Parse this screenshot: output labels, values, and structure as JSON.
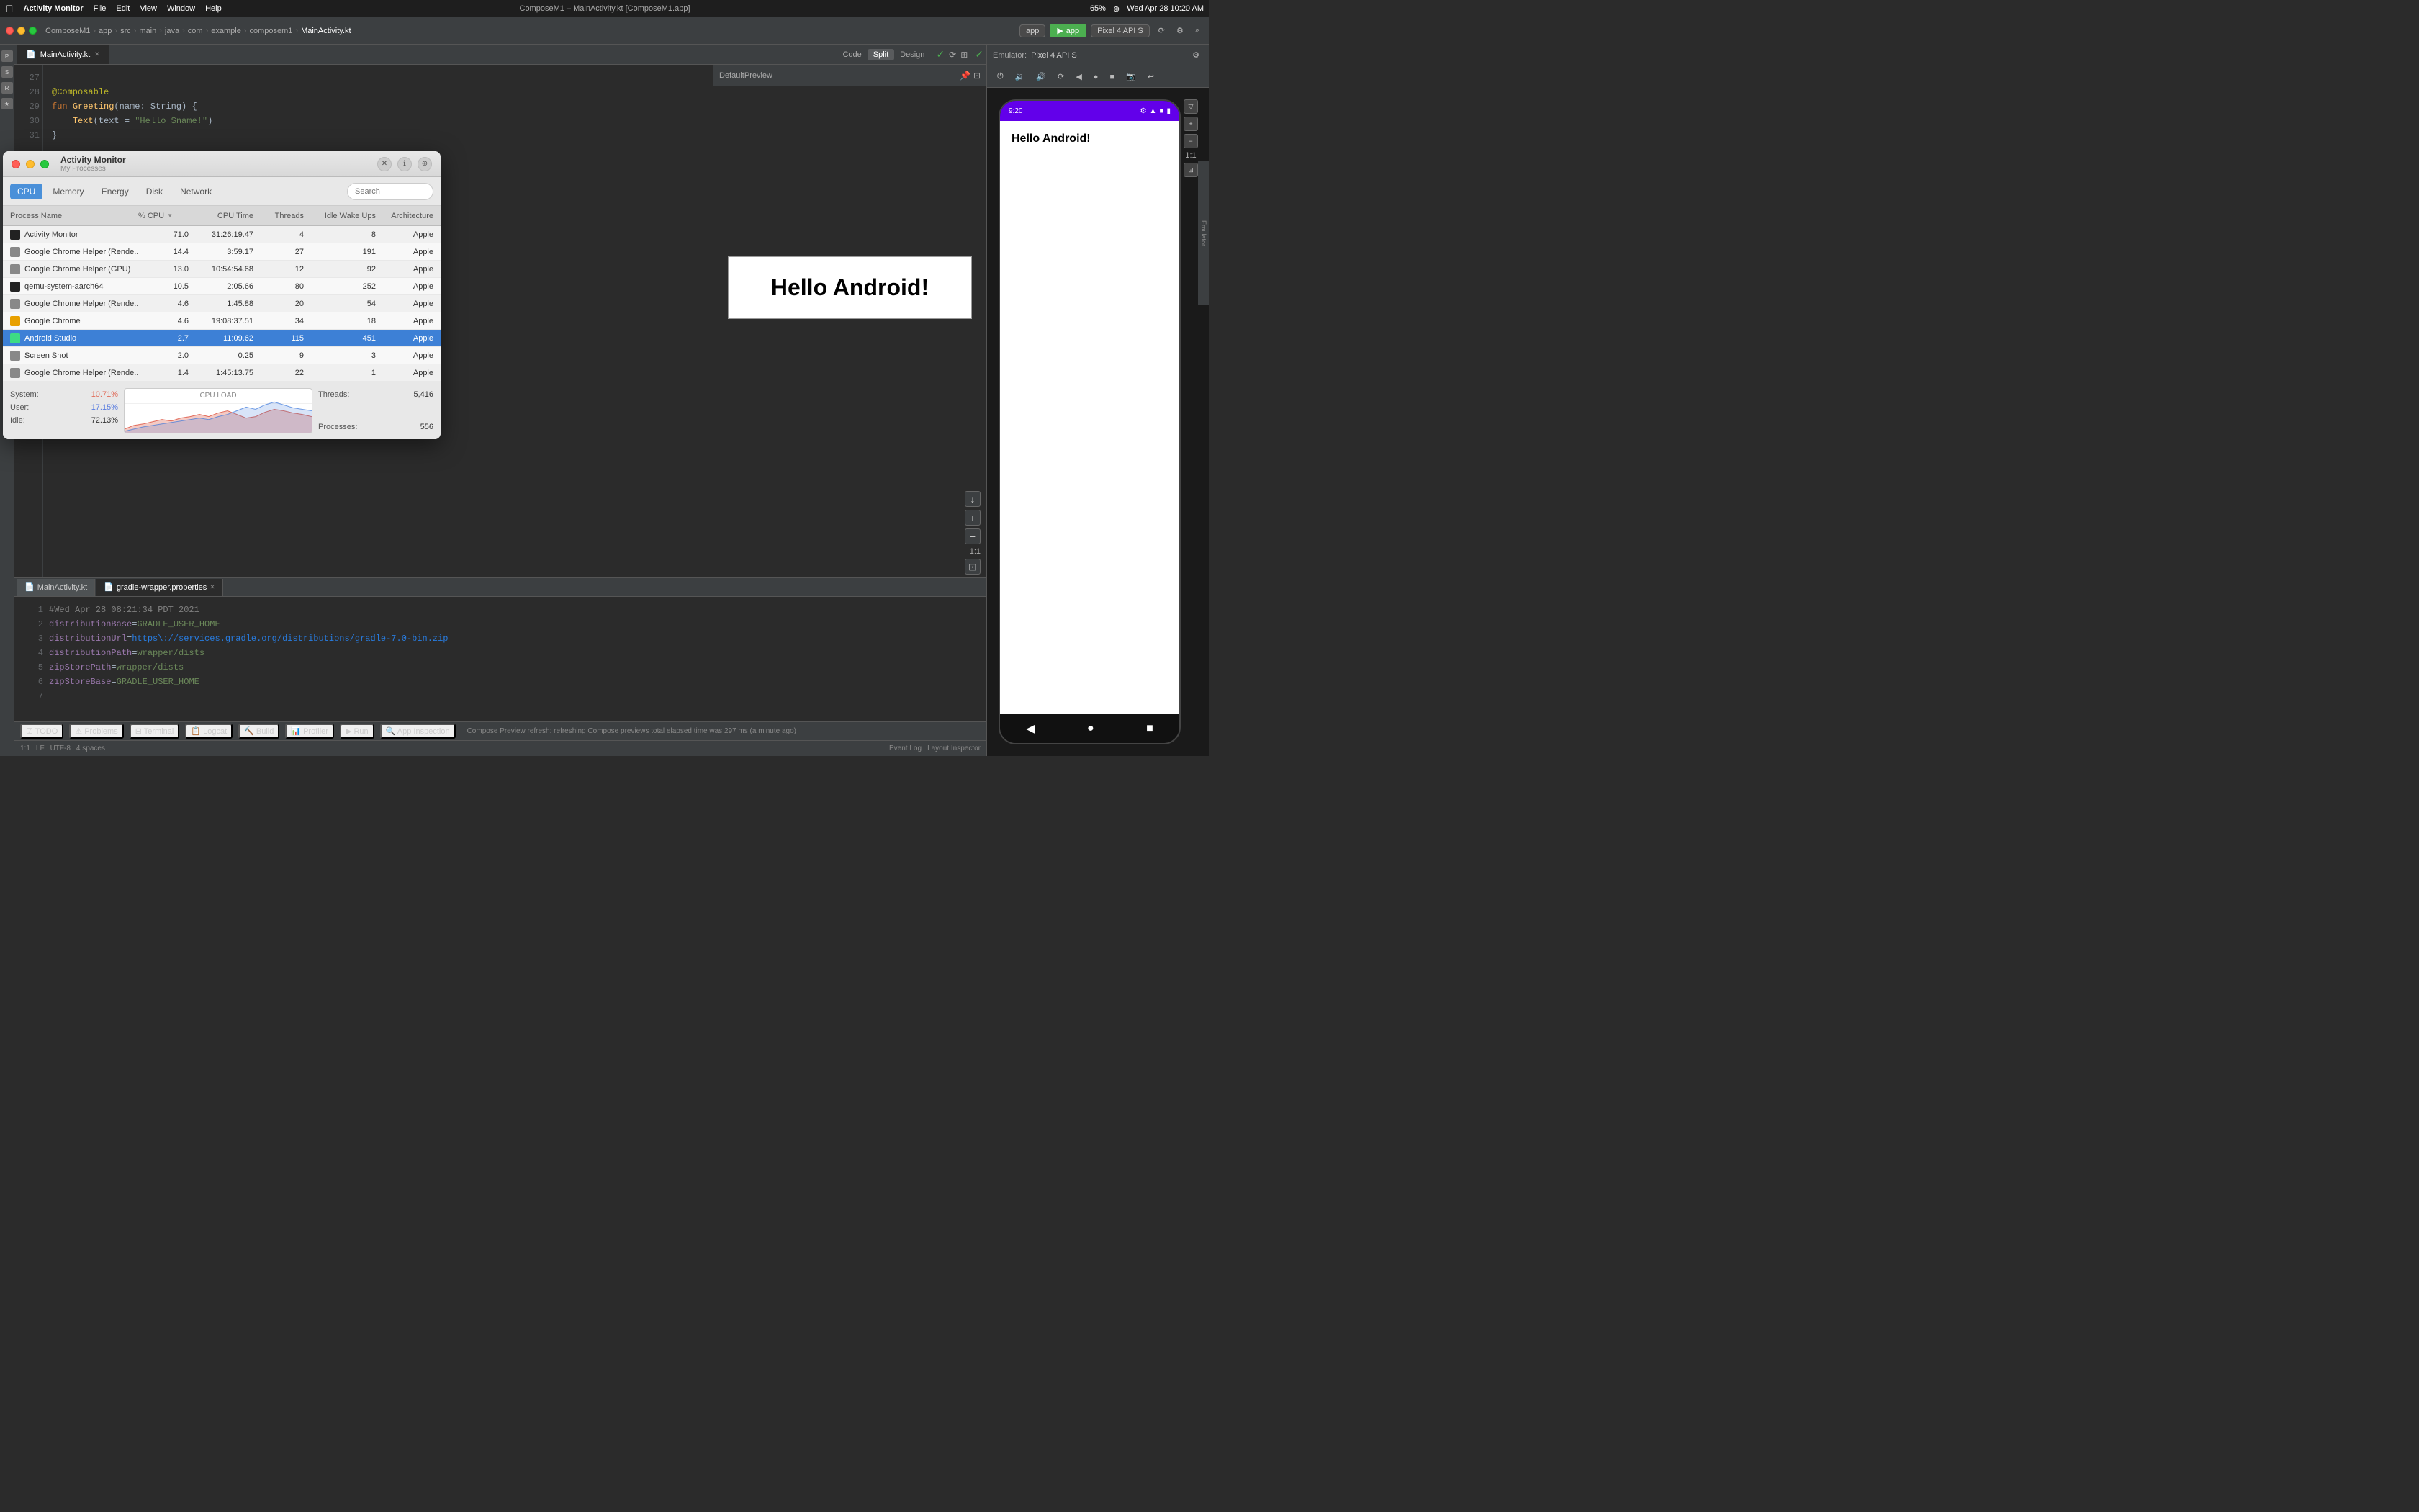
{
  "menubar": {
    "app_menu": "Activity Monitor",
    "menus": [
      "File",
      "Edit",
      "View",
      "Window",
      "Help"
    ],
    "center_title": "ComposeM1 – MainActivity.kt [ComposeM1.app]",
    "right_items": [
      "65%",
      "Wed Apr 28  10:20 AM"
    ]
  },
  "ide": {
    "title": "ComposeM1 – MainActivity.kt [ComposeM1.app]",
    "breadcrumbs": [
      "ComposeM1",
      "app",
      "src",
      "main",
      "java",
      "com",
      "example",
      "composem1",
      "MainActivity.kt"
    ],
    "tabs": {
      "editor": [
        "MainActivity.kt"
      ],
      "bottom": [
        "MainActivity.kt",
        "gradle-wrapper.properties"
      ]
    },
    "active_bottom_tab": "gradle-wrapper.properties",
    "run_config": "app",
    "device": "Pixel 4 API S",
    "view_tabs": [
      "Code",
      "Split",
      "Design"
    ],
    "active_view_tab": "Split"
  },
  "code": {
    "lines": [
      {
        "num": "27",
        "content": ""
      },
      {
        "num": "28",
        "content": "    @Composable"
      },
      {
        "num": "29",
        "content": "    fun Greeting(name: String) {"
      },
      {
        "num": "30",
        "content": "        Text(text = \"Hello $name!\")"
      },
      {
        "num": "31",
        "content": "    }"
      }
    ]
  },
  "gradle": {
    "lines": [
      {
        "num": "1",
        "content": "#Wed Apr 28 08:21:34 PDT 2021",
        "type": "comment"
      },
      {
        "num": "2",
        "content": "distributionBase=GRADLE_USER_HOME",
        "type": "prop"
      },
      {
        "num": "3",
        "content": "distributionUrl=https\\://services.gradle.org/distributions/gradle-7.0-bin.zip",
        "type": "url"
      },
      {
        "num": "4",
        "content": "distributionPath=wrapper/dists",
        "type": "prop"
      },
      {
        "num": "5",
        "content": "zipStorePath=wrapper/dists",
        "type": "prop"
      },
      {
        "num": "6",
        "content": "zipStoreBase=GRADLE_USER_HOME",
        "type": "prop"
      },
      {
        "num": "7",
        "content": "",
        "type": "empty"
      }
    ]
  },
  "preview": {
    "label": "DefaultPreview",
    "text": "Hello Android!",
    "zoom_levels": [
      "1:1",
      "+",
      "-",
      "fit"
    ]
  },
  "emulator": {
    "label": "Emulator:",
    "device": "Pixel 4 API S",
    "phone": {
      "time": "9:20",
      "title": "Hello Android!",
      "content": "Hello Android!",
      "nav_back": "◀",
      "nav_home": "●",
      "nav_recents": "■"
    }
  },
  "activity_monitor": {
    "title": "Activity Monitor",
    "subtitle": "My Processes",
    "tabs": [
      "CPU",
      "Memory",
      "Energy",
      "Disk",
      "Network"
    ],
    "active_tab": "CPU",
    "columns": [
      "Process Name",
      "% CPU",
      "CPU Time",
      "Threads",
      "Idle Wake Ups",
      "Architecture"
    ],
    "processes": [
      {
        "icon": "black",
        "name": "Activity Monitor",
        "cpu": "71.0",
        "cputime": "31:26:19.47",
        "threads": "4",
        "idle": "8",
        "arch": "Apple"
      },
      {
        "icon": "gray",
        "name": "Google Chrome Helper (Rende...",
        "cpu": "14.4",
        "cputime": "3:59.17",
        "threads": "27",
        "idle": "191",
        "arch": "Apple"
      },
      {
        "icon": "gray",
        "name": "Google Chrome Helper (GPU)",
        "cpu": "13.0",
        "cputime": "10:54:54.68",
        "threads": "12",
        "idle": "92",
        "arch": "Apple"
      },
      {
        "icon": "black",
        "name": "qemu-system-aarch64",
        "cpu": "10.5",
        "cputime": "2:05.66",
        "threads": "80",
        "idle": "252",
        "arch": "Apple"
      },
      {
        "icon": "gray",
        "name": "Google Chrome Helper (Rende...",
        "cpu": "4.6",
        "cputime": "1:45.88",
        "threads": "20",
        "idle": "54",
        "arch": "Apple"
      },
      {
        "icon": "chrome",
        "name": "Google Chrome",
        "cpu": "4.6",
        "cputime": "19:08:37.51",
        "threads": "34",
        "idle": "18",
        "arch": "Apple"
      },
      {
        "icon": "android",
        "name": "Android Studio",
        "cpu": "2.7",
        "cputime": "11:09.62",
        "threads": "115",
        "idle": "451",
        "arch": "Apple",
        "selected": true
      },
      {
        "icon": "gray",
        "name": "Screen Shot",
        "cpu": "2.0",
        "cputime": "0.25",
        "threads": "9",
        "idle": "3",
        "arch": "Apple"
      },
      {
        "icon": "gray",
        "name": "Google Chrome Helper (Rende...",
        "cpu": "1.4",
        "cputime": "1:45:13.75",
        "threads": "22",
        "idle": "1",
        "arch": "Apple"
      }
    ],
    "footer": {
      "system_label": "System:",
      "system_value": "10.71%",
      "user_label": "User:",
      "user_value": "17.15%",
      "idle_label": "Idle:",
      "idle_value": "72.13%",
      "chart_label": "CPU LOAD",
      "threads_label": "Threads:",
      "threads_value": "5,416",
      "processes_label": "Processes:",
      "processes_value": "556"
    }
  },
  "bottom_toolbar": {
    "tools": [
      "TODO",
      "Problems",
      "Terminal",
      "Logcat",
      "Build",
      "Profiler",
      "Run",
      "App Inspection"
    ],
    "status": "Compose Preview refresh: refreshing Compose previews total elapsed time was 297 ms (a minute ago)"
  },
  "statusbar": {
    "left": "1:1",
    "encoding": "UTF-8",
    "line_sep": "LF",
    "indent": "4 spaces",
    "right_tools": [
      "Event Log",
      "Layout Inspector"
    ]
  }
}
